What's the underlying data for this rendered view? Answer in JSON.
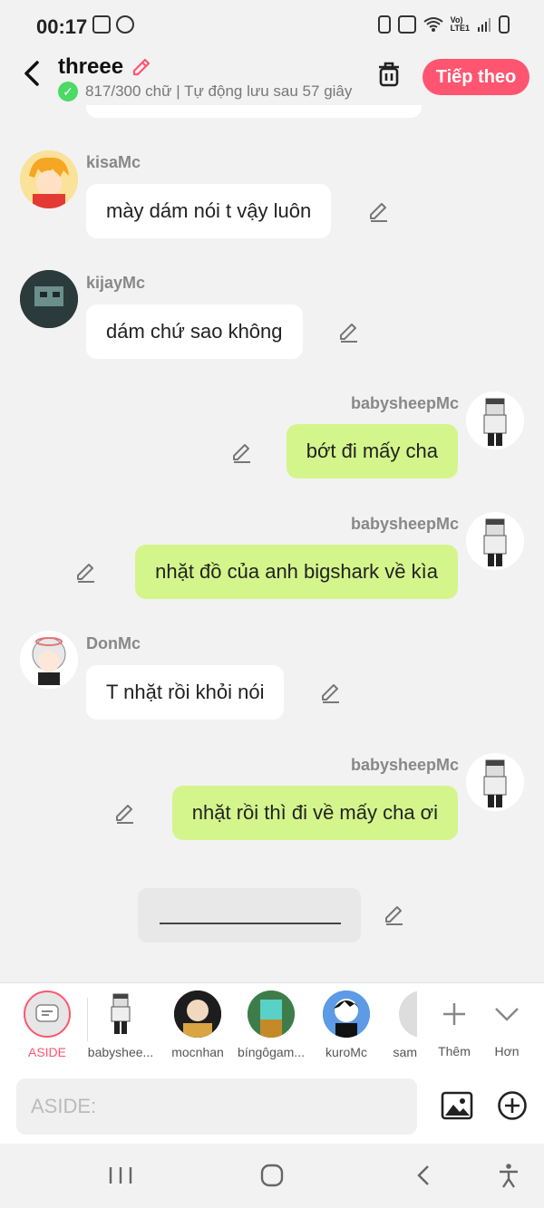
{
  "status_bar": {
    "time": "00:17"
  },
  "header": {
    "title": "threee",
    "subtitle": "817/300 chữ | Tự động lưu sau 57 giây",
    "next_label": "Tiếp theo"
  },
  "messages": [
    {
      "sender": "kisaMc",
      "text": "mày dám nói t vậy luôn",
      "side": "left"
    },
    {
      "sender": "kijayMc",
      "text": "dám chứ sao không",
      "side": "left"
    },
    {
      "sender": "babysheepMc",
      "text": "bớt đi mấy cha",
      "side": "right"
    },
    {
      "sender": "babysheepMc",
      "text": "nhặt đồ của anh bigshark về kìa",
      "side": "right"
    },
    {
      "sender": "DonMc",
      "text": "T nhặt rồi khỏi nói",
      "side": "left"
    },
    {
      "sender": "babysheepMc",
      "text": "nhặt rồi thì đi về mấy cha ơi",
      "side": "right"
    }
  ],
  "character_bar": {
    "aside_label": "ASIDE",
    "characters": [
      "babyshee...",
      "mocnhan",
      "bíngôgam...",
      "kuroMc",
      "sam"
    ],
    "add_label": "Thêm",
    "more_label": "Hơn"
  },
  "input": {
    "placeholder": "ASIDE:"
  },
  "colors": {
    "accent": "#ff5570",
    "right_bubble": "#d4f58c",
    "left_bubble": "#ffffff"
  }
}
